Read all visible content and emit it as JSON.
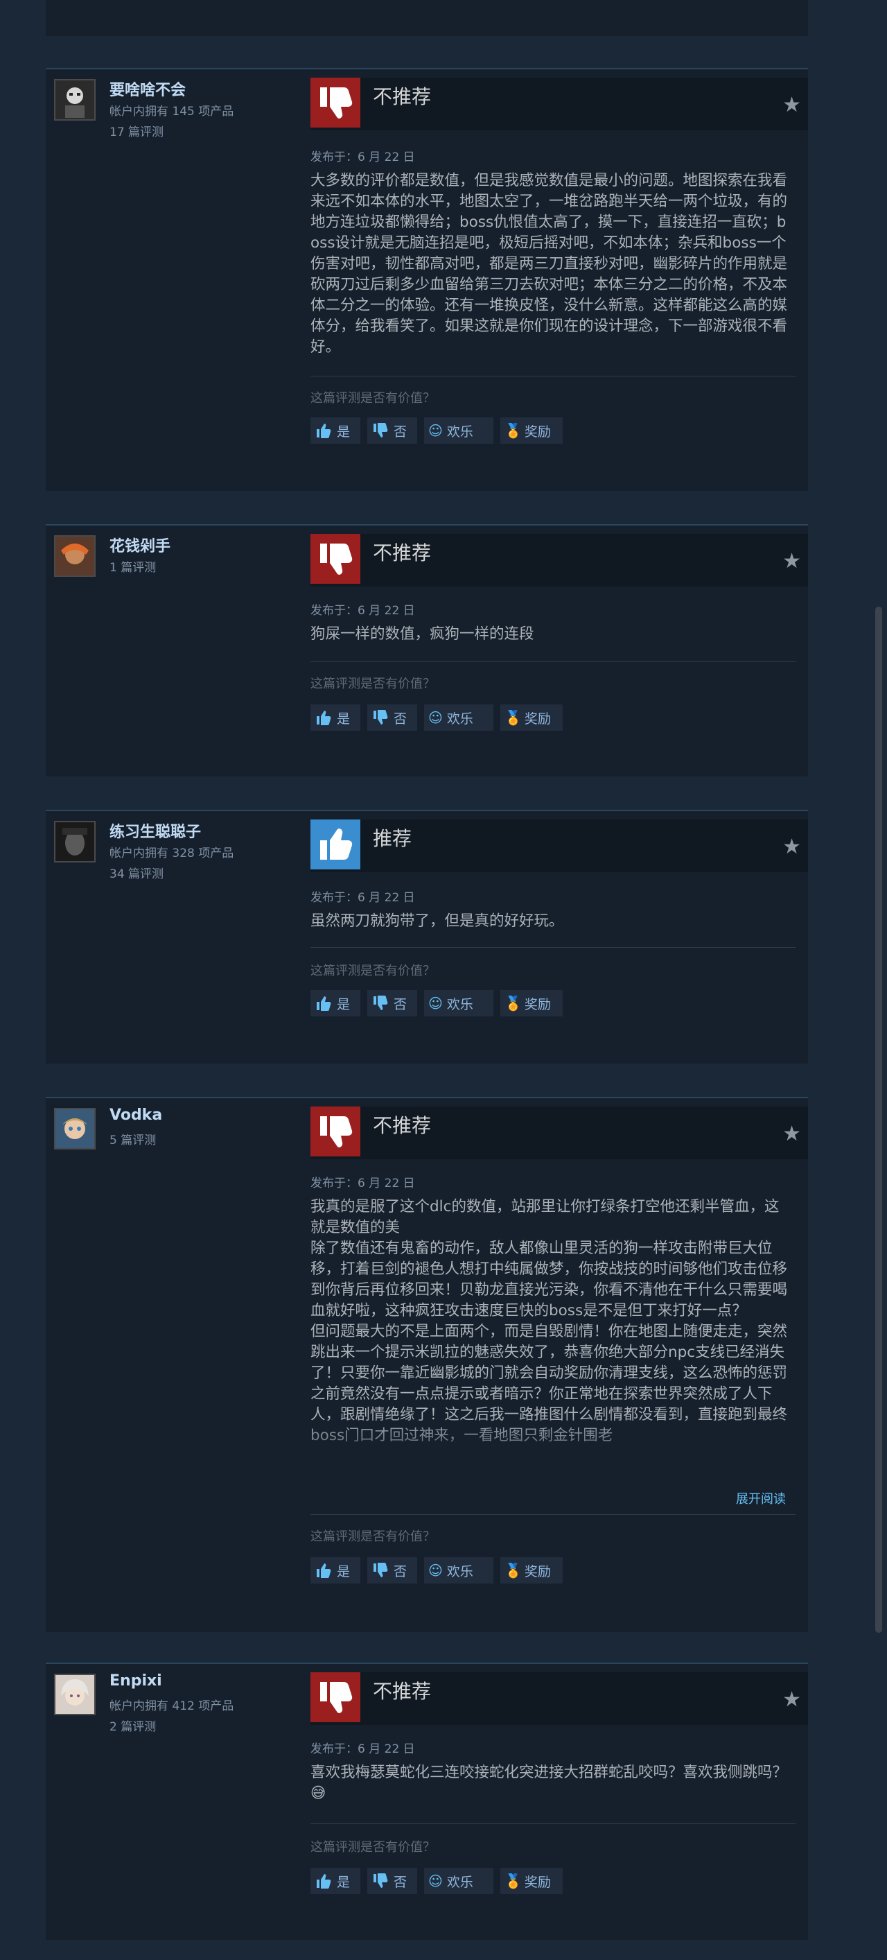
{
  "reviews": [
    {
      "username": "要啥啥不会",
      "owned": "帐户内拥有 145 项产品",
      "review_count": "17 篇评测",
      "verdict": "不推荐",
      "recommended": false,
      "posted": "发布于：6 月 22 日",
      "paragraphs": [
        "大多数的评价都是数值，但是我感觉数值是最小的问题。地图探索在我看来远不如本体的水平，地图太空了，一堆岔路跑半天给一两个垃圾，有的地方连垃圾都懒得给；boss仇恨值太高了，摸一下，直接连招一直砍；boss设计就是无脑连招是吧，极短后摇对吧，不如本体；杂兵和boss一个伤害对吧，韧性都高对吧，都是两三刀直接秒对吧，幽影碎片的作用就是砍两刀过后剩多少血留给第三刀去砍对吧；本体三分之二的价格，不及本体二分之一的体验。还有一堆换皮怪，没什么新意。这样都能这么高的媒体分，给我看笑了。如果这就是你们现在的设计理念，下一部游戏很不看好。"
      ],
      "expand": ""
    },
    {
      "username": "花钱剁手",
      "owned": "",
      "review_count": "1 篇评测",
      "verdict": "不推荐",
      "recommended": false,
      "posted": "发布于：6 月 22 日",
      "paragraphs": [
        "狗屎一样的数值，疯狗一样的连段"
      ],
      "expand": ""
    },
    {
      "username": "练习生聪聪子",
      "owned": "帐户内拥有 328 项产品",
      "review_count": "34 篇评测",
      "verdict": "推荐",
      "recommended": true,
      "posted": "发布于：6 月 22 日",
      "paragraphs": [
        "虽然两刀就狗带了，但是真的好好玩。"
      ],
      "expand": ""
    },
    {
      "username": "Vodka",
      "owned": "",
      "review_count": "5 篇评测",
      "verdict": "不推荐",
      "recommended": false,
      "posted": "发布于：6 月 22 日",
      "paragraphs": [
        "我真的是服了这个dlc的数值，站那里让你打绿条打空他还剩半管血，这就是数值的美",
        "除了数值还有鬼畜的动作，敌人都像山里灵活的狗一样攻击附带巨大位移，打着巨剑的褪色人想打中纯属做梦，你按战技的时间够他们攻击位移到你背后再位移回来！贝勒龙直接光污染，你看不清他在干什么只需要喝血就好啦，这种疯狂攻击速度巨快的boss是不是但丁来打好一点？",
        "但问题最大的不是上面两个，而是自毁剧情！你在地图上随便走走，突然跳出来一个提示米凯拉的魅惑失效了，恭喜你绝大部分npc支线已经消失了！只要你一靠近幽影城的门就会自动奖励你清理支线，这么恐怖的惩罚之前竟然没有一点点提示或者暗示？你正常地在探索世界突然成了人下人，跟剧情绝缘了！这之后我一路推图什么剧情都没看到，直接跑到最终boss门口才回过神来，一看地图只剩金针围老"
      ],
      "expand": "展开阅读"
    },
    {
      "username": "Enpixi",
      "owned": "帐户内拥有 412 项产品",
      "review_count": "2 篇评测",
      "verdict": "不推荐",
      "recommended": false,
      "posted": "发布于：6 月 22 日",
      "paragraphs": [
        "喜欢我梅瑟莫蛇化三连咬接蛇化突进接大招群蛇乱咬吗？喜欢我侧跳吗？😅"
      ],
      "expand": ""
    }
  ],
  "helpful_prompt": "这篇评测是否有价值？",
  "buttons": {
    "yes": "是",
    "no": "否",
    "funny": "欢乐",
    "award": "奖励"
  },
  "icons": {
    "thumbs_down": "thumbs-down-icon",
    "thumbs_up": "thumbs-up-icon",
    "star": "star-icon",
    "funny": "smiley-icon",
    "award": "award-icon"
  },
  "colors": {
    "background": "#1b2838",
    "card": "#16202d",
    "negative": "#9c1f1f",
    "positive": "#3a8ed0",
    "username": "#c1dbf4",
    "link": "#66c0f4"
  }
}
